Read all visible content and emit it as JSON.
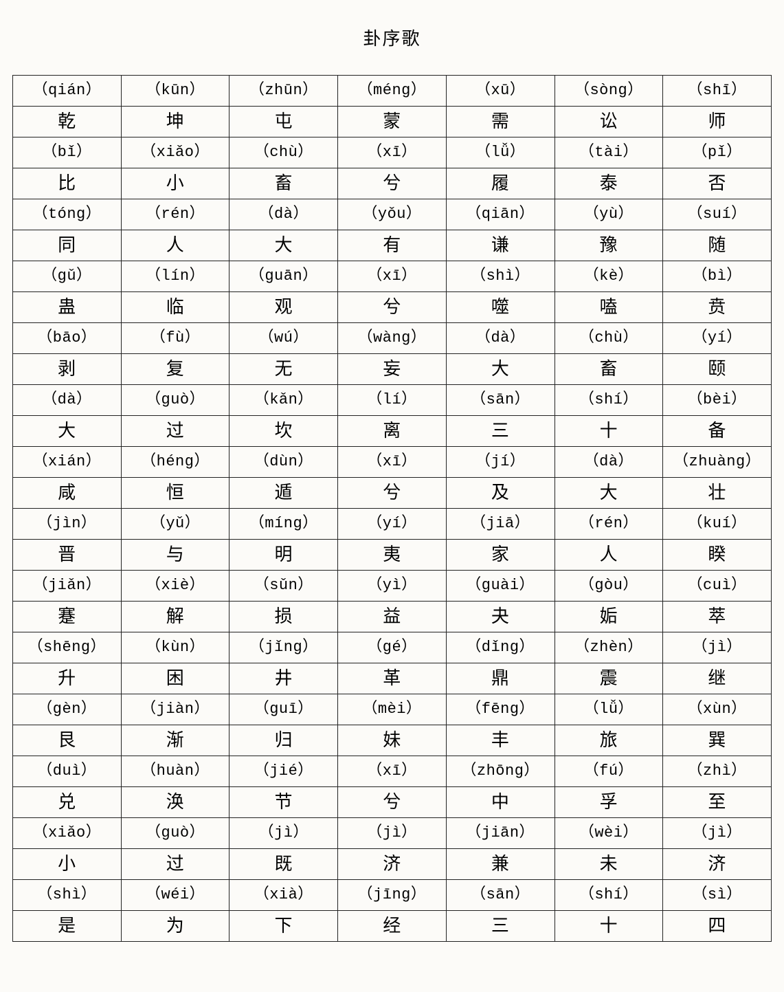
{
  "title": "卦序歌",
  "rows": [
    {
      "pinyin": [
        "（qián）",
        "（kūn）",
        "（zhūn）",
        "（méng）",
        "（xū）",
        "（sòng）",
        "（shī）"
      ],
      "char": [
        "乾",
        "坤",
        "屯",
        "蒙",
        "需",
        "讼",
        "师"
      ]
    },
    {
      "pinyin": [
        "（bǐ）",
        "（xiǎo）",
        "（chù）",
        "（xī）",
        "（lǚ）",
        "（tài）",
        "（pǐ）"
      ],
      "char": [
        "比",
        "小",
        "畜",
        "兮",
        "履",
        "泰",
        "否"
      ]
    },
    {
      "pinyin": [
        "（tóng）",
        "（rén）",
        "（dà）",
        "（yǒu）",
        "（qiān）",
        "（yù）",
        "（suí）"
      ],
      "char": [
        "同",
        "人",
        "大",
        "有",
        "谦",
        "豫",
        "随"
      ]
    },
    {
      "pinyin": [
        "（gǔ）",
        "（lín）",
        "（guān）",
        "（xī）",
        "（shì）",
        "（kè）",
        "（bì）"
      ],
      "char": [
        "蛊",
        "临",
        "观",
        "兮",
        "噬",
        "嗑",
        "贲"
      ]
    },
    {
      "pinyin": [
        "（bāo）",
        "（fù）",
        "（wú）",
        "（wàng）",
        "（dà）",
        "（chù）",
        "（yí）"
      ],
      "char": [
        "剥",
        "复",
        "无",
        "妄",
        "大",
        "畜",
        "颐"
      ]
    },
    {
      "pinyin": [
        "（dà）",
        "（guò）",
        "（kǎn）",
        "（lí）",
        "（sān）",
        "（shí）",
        "（bèi）"
      ],
      "char": [
        "大",
        "过",
        "坎",
        "离",
        "三",
        "十",
        "备"
      ]
    },
    {
      "pinyin": [
        "（xián）",
        "（héng）",
        "（dùn）",
        "（xī）",
        "（jí）",
        "（dà）",
        "（zhuàng）"
      ],
      "char": [
        "咸",
        "恒",
        "遁",
        "兮",
        "及",
        "大",
        "壮"
      ]
    },
    {
      "pinyin": [
        "（jìn）",
        "（yǔ）",
        "（míng）",
        "（yí）",
        "（jiā）",
        "（rén）",
        "（kuí）"
      ],
      "char": [
        "晋",
        "与",
        "明",
        "夷",
        "家",
        "人",
        "睽"
      ]
    },
    {
      "pinyin": [
        "（jiǎn）",
        "（xiè）",
        "（sǔn）",
        "（yì）",
        "（guài）",
        "（gòu）",
        "（cuì）"
      ],
      "char": [
        "蹇",
        "解",
        "损",
        "益",
        "夬",
        "姤",
        "萃"
      ]
    },
    {
      "pinyin": [
        "（shēng）",
        "（kùn）",
        "（jǐng）",
        "（gé）",
        "（dǐng）",
        "（zhèn）",
        "（jì）"
      ],
      "char": [
        "升",
        "困",
        "井",
        "革",
        "鼎",
        "震",
        "继"
      ]
    },
    {
      "pinyin": [
        "（gèn）",
        "（jiàn）",
        "（guī）",
        "（mèi）",
        "（fēng）",
        "（lǚ）",
        "（xùn）"
      ],
      "char": [
        "艮",
        "渐",
        "归",
        "妹",
        "丰",
        "旅",
        "巽"
      ]
    },
    {
      "pinyin": [
        "（duì）",
        "（huàn）",
        "（jié）",
        "（xī）",
        "（zhōng）",
        "（fú）",
        "（zhì）"
      ],
      "char": [
        "兑",
        "涣",
        "节",
        "兮",
        "中",
        "孚",
        "至"
      ]
    },
    {
      "pinyin": [
        "（xiǎo）",
        "（guò）",
        "（jì）",
        "（jì）",
        "（jiān）",
        "（wèi）",
        "（jì）"
      ],
      "char": [
        "小",
        "过",
        "既",
        "济",
        "兼",
        "未",
        "济"
      ]
    },
    {
      "pinyin": [
        "（shì）",
        "（wéi）",
        "（xià）",
        "（jīng）",
        "（sān）",
        "（shí）",
        "（sì）"
      ],
      "char": [
        "是",
        "为",
        "下",
        "经",
        "三",
        "十",
        "四"
      ]
    }
  ]
}
